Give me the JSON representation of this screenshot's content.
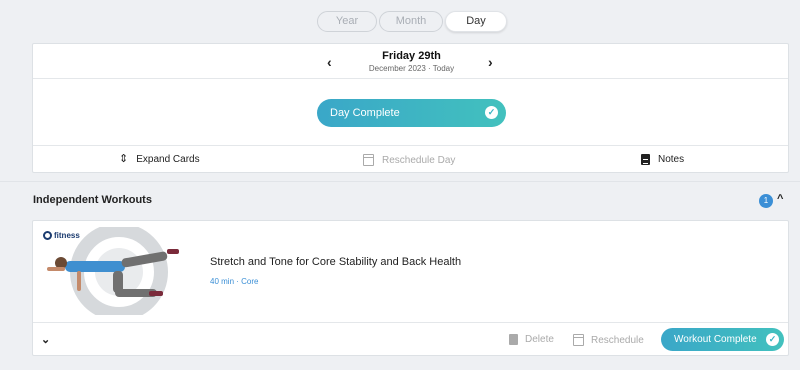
{
  "view_switch": {
    "year": "Year",
    "month": "Month",
    "day": "Day",
    "selected": "Day"
  },
  "date_nav": {
    "prev": "‹",
    "next": "›",
    "title": "Friday 29th",
    "subtitle": "December 2023 · Today"
  },
  "day_status": {
    "label": "Day Complete",
    "check": "✓"
  },
  "day_actions": {
    "expand": {
      "icon": "⇕",
      "label": "Expand Cards"
    },
    "reschedule": {
      "label": "Reschedule Day"
    },
    "notes": {
      "label": "Notes"
    }
  },
  "section": {
    "title": "Independent Workouts",
    "count": "1",
    "collapse": "^"
  },
  "workout": {
    "logo_text": "fitness",
    "title": "Stretch and Tone for Core Stability and Back Health",
    "meta": "40 min · Core",
    "expand": "⌄",
    "delete_label": "Delete",
    "reschedule_label": "Reschedule",
    "complete_label": "Workout Complete",
    "check": "✓"
  },
  "colors": {
    "accent_start": "#3aa7c8",
    "accent_end": "#42c1be",
    "badge": "#3b8fd6",
    "disabled": "#aaaaaa"
  }
}
